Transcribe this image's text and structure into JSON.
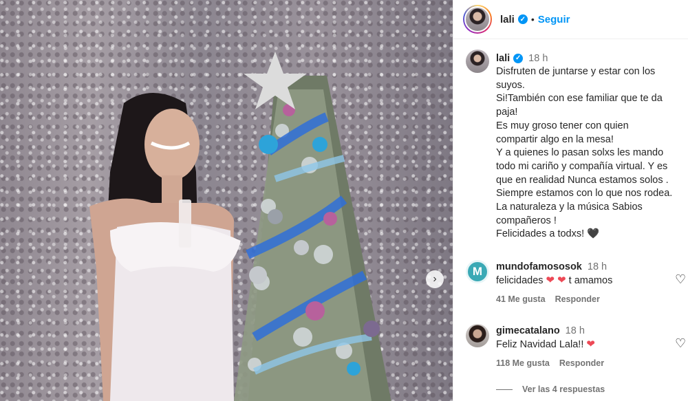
{
  "header": {
    "username": "lali",
    "separator": "•",
    "follow_label": "Seguir"
  },
  "caption": {
    "username": "lali",
    "time": "18 h",
    "lines": [
      "Disfruten de juntarse y estar con los",
      "suyos.",
      "Si!También con ese familiar que te da",
      "paja!",
      "Es muy groso tener con quien",
      "compartir algo en la mesa!",
      "Y a quienes lo pasan solxs les mando",
      "todo mi cariño y compañía virtual. Y es",
      "que en realidad Nunca estamos solos .",
      "Siempre estamos con lo que nos rodea.",
      "La naturaleza y la música Sabios",
      "compañeros !",
      "Felicidades a todxs! 🖤"
    ]
  },
  "comments": [
    {
      "username": "mundofamososok",
      "time": "18 h",
      "text": "felicidades",
      "suffix": "t amamos",
      "likes": "41 Me gusta",
      "reply_label": "Responder",
      "avatar_letter": "M"
    },
    {
      "username": "gimecatalano",
      "time": "18 h",
      "text": "Feliz Navidad Lala!!",
      "likes": "118 Me gusta",
      "reply_label": "Responder"
    }
  ],
  "view_replies": "Ver las 4 respuestas",
  "icons": {
    "verified": "verified-badge-icon",
    "heart_outline": "heart-outline-icon",
    "heart_red": "heart-red-icon",
    "next": "chevron-right-icon"
  },
  "colors": {
    "accent": "#0095f6",
    "text": "#262626",
    "muted": "#737373",
    "heart": "#ed4956"
  }
}
